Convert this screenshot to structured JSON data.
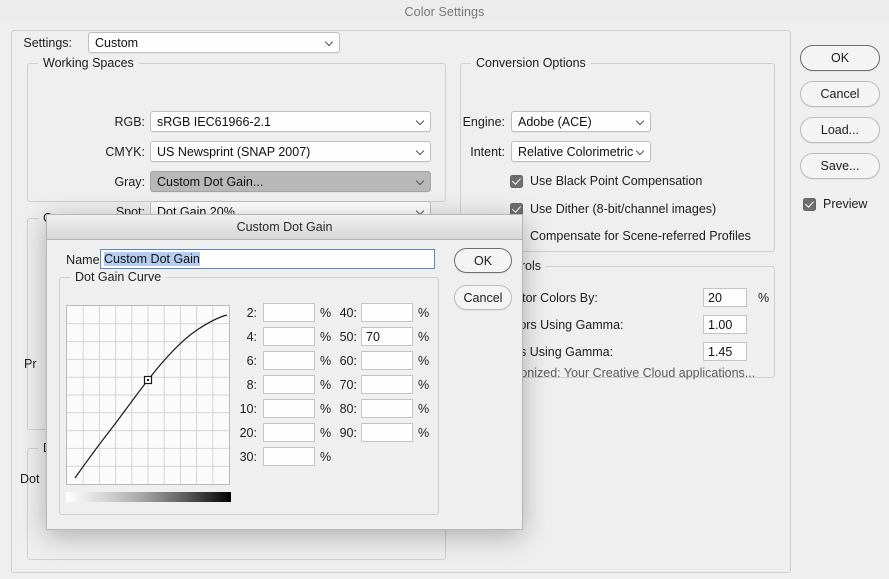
{
  "window": {
    "title": "Color Settings"
  },
  "settings_row": {
    "label": "Settings:",
    "value": "Custom"
  },
  "working_spaces": {
    "legend": "Working Spaces",
    "rows": [
      {
        "label": "RGB:",
        "value": "sRGB IEC61966-2.1"
      },
      {
        "label": "CMYK:",
        "value": "US Newsprint (SNAP 2007)"
      },
      {
        "label": "Gray:",
        "value": "Custom Dot Gain..."
      },
      {
        "label": "Spot:",
        "value": "Dot Gain 20%"
      }
    ]
  },
  "color_management_policies": {
    "legend": "C"
  },
  "description": {
    "legend": "De",
    "text": "Dot"
  },
  "profile_mismatch": {
    "text": "Pr"
  },
  "conversion_options": {
    "legend": "Conversion Options",
    "engine_label": "Engine:",
    "engine_value": "Adobe (ACE)",
    "intent_label": "Intent:",
    "intent_value": "Relative Colorimetric",
    "checkboxes": [
      "Use Black Point Compensation",
      "Use Dither (8-bit/channel images)",
      "Compensate for Scene-referred Profiles"
    ]
  },
  "advanced_controls": {
    "legend": "d Controls",
    "rows": [
      {
        "label": "rate Monitor Colors By:",
        "value": "20",
        "unit": "%"
      },
      {
        "label": "RGB Colors Using Gamma:",
        "value": "1.00",
        "unit": ""
      },
      {
        "label": "ext Colors Using Gamma:",
        "value": "1.45",
        "unit": ""
      }
    ],
    "sync_note": "nchronized: Your Creative Cloud applications..."
  },
  "side_buttons": [
    {
      "label": "OK",
      "default": true
    },
    {
      "label": "Cancel",
      "default": false
    },
    {
      "label": "Load...",
      "default": false
    },
    {
      "label": "Save...",
      "default": false
    }
  ],
  "preview": {
    "label": "Preview",
    "checked": true
  },
  "modal": {
    "title": "Custom Dot Gain",
    "name_label": "Name:",
    "name_value": "Custom Dot Gain",
    "curve_legend": "Dot Gain Curve",
    "buttons": [
      {
        "label": "OK",
        "default": true
      },
      {
        "label": "Cancel",
        "default": false
      }
    ],
    "fields_left": [
      {
        "label": "2:",
        "value": "",
        "unit": "%"
      },
      {
        "label": "4:",
        "value": "",
        "unit": "%"
      },
      {
        "label": "6:",
        "value": "",
        "unit": "%"
      },
      {
        "label": "8:",
        "value": "",
        "unit": "%"
      },
      {
        "label": "10:",
        "value": "",
        "unit": "%"
      },
      {
        "label": "20:",
        "value": "",
        "unit": "%"
      },
      {
        "label": "30:",
        "value": "",
        "unit": "%"
      }
    ],
    "fields_right": [
      {
        "label": "40:",
        "value": "",
        "unit": "%"
      },
      {
        "label": "50:",
        "value": "70",
        "unit": "%"
      },
      {
        "label": "60:",
        "value": "",
        "unit": "%"
      },
      {
        "label": "70:",
        "value": "",
        "unit": "%"
      },
      {
        "label": "80:",
        "value": "",
        "unit": "%"
      },
      {
        "label": "90:",
        "value": "",
        "unit": "%"
      }
    ]
  },
  "chart_data": {
    "type": "line",
    "title": "Dot Gain Curve",
    "xlabel": "",
    "ylabel": "",
    "xlim": [
      0,
      100
    ],
    "ylim": [
      0,
      100
    ],
    "grid": true,
    "legend": "none",
    "x": [
      0,
      10,
      20,
      30,
      40,
      50,
      60,
      70,
      80,
      90,
      100
    ],
    "y": [
      0,
      18,
      32,
      45,
      58,
      70,
      79,
      87,
      93,
      97,
      100
    ],
    "control_points": [
      {
        "x": 50,
        "y": 70
      }
    ]
  }
}
